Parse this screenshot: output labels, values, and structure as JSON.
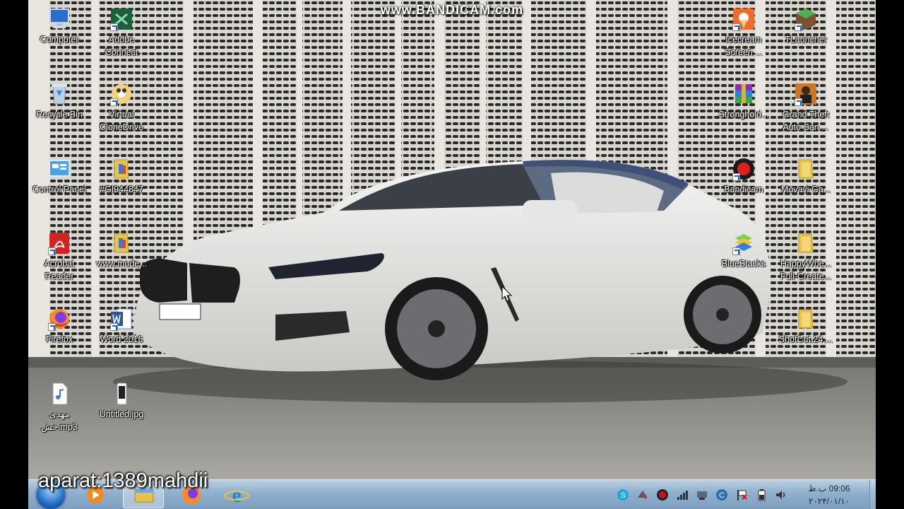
{
  "watermark": "www.BANDICAM.com",
  "overlay_text": "aparat:1389mahdii",
  "desktop_icons": [
    {
      "label": "Computer",
      "icon": "computer-icon"
    },
    {
      "label": "Adobe Connect",
      "icon": "adobe-connect-icon"
    },
    {
      "label": "Recycle Bin",
      "icon": "recycle-bin-icon"
    },
    {
      "label": "Virtual CloneDrive",
      "icon": "virtual-clonedrive-icon"
    },
    {
      "label": "Control Panel",
      "icon": "control-panel-icon"
    },
    {
      "label": "#GI944847",
      "icon": "folder-icon"
    },
    {
      "label": "Acrobat Reader",
      "icon": "acrobat-reader-icon"
    },
    {
      "label": "www.mode...",
      "icon": "folder-icon"
    },
    {
      "label": "Firefox",
      "icon": "firefox-icon"
    },
    {
      "label": "Word 2016",
      "icon": "word-icon"
    },
    {
      "label": "مهدی خش.mp3",
      "icon": "mp3-file-icon"
    },
    {
      "label": "Untitled.jpg",
      "icon": "jpg-file-icon"
    },
    {
      "label": "Icecream Screen ...",
      "icon": "icecream-screen-icon"
    },
    {
      "label": "TLauncher",
      "icon": "tlauncher-icon"
    },
    {
      "label": "Stronghold...",
      "icon": "winrar-icon"
    },
    {
      "label": "Grand Theft Auto San ...",
      "icon": "gta-icon"
    },
    {
      "label": "Bandicam",
      "icon": "bandicam-icon"
    },
    {
      "label": "Movavi Ga...",
      "icon": "folder-icon"
    },
    {
      "label": "BlueStacks",
      "icon": "bluestacks-icon"
    },
    {
      "label": "HappyWhe... Full-Create...",
      "icon": "folder-icon"
    },
    {
      "label": "ShotCut.24....",
      "icon": "folder-icon"
    }
  ],
  "taskbar": {
    "start": "start-orb-icon",
    "pinned": [
      "media-player-icon",
      "file-explorer-icon",
      "firefox-icon",
      "internet-explorer-icon"
    ]
  },
  "tray": {
    "icons": [
      "skype-icon",
      "network-tool-icon",
      "record-icon",
      "signal-icon",
      "device-icon",
      "app-c-icon",
      "flag-icon",
      "battery-icon",
      "volume-icon"
    ],
    "time": "09:06 ب.ظ",
    "date": "۲۰۲۴/۰۱/۱۰"
  },
  "colors": {
    "taskbar": "#8eaecb",
    "record": "#d01010",
    "folder": "#e8c34a"
  }
}
